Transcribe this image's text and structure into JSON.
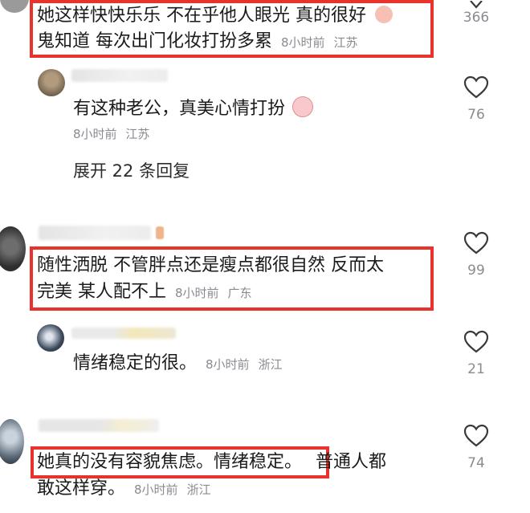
{
  "comments": [
    {
      "text_line1": "她这样快快乐乐 不在乎他人眼光 真的很好",
      "text_line2": "鬼知道 每次出门化妆打扮多累",
      "time": "8小时前",
      "location": "江苏",
      "likes": "366",
      "emoji_icon": "smiling-face-icon"
    },
    {
      "text": "有这种老公，真美心情打扮",
      "time": "8小时前",
      "location": "江苏",
      "likes": "76",
      "emoji_icon": "crying-laughing-icon"
    },
    {
      "expand_label": "展开 22 条回复"
    },
    {
      "text_line1": "随性洒脱 不管胖点还是瘦点都很自然 反而太",
      "text_line2": "完美 某人配不上",
      "time": "8小时前",
      "location": "广东",
      "likes": "99"
    },
    {
      "text": "情绪稳定的很。",
      "time": "8小时前",
      "location": "浙江",
      "likes": "21"
    },
    {
      "text_line1_a": "她真的没有容貌焦虑。情绪稳定。",
      "text_line1_b": "普通人都",
      "text_line2": "敢这样穿。",
      "time": "8小时前",
      "location": "浙江",
      "likes": "74"
    }
  ],
  "colors": {
    "highlight": "#e8322b",
    "meta": "#8a8b91",
    "text": "#1b1b1b"
  }
}
